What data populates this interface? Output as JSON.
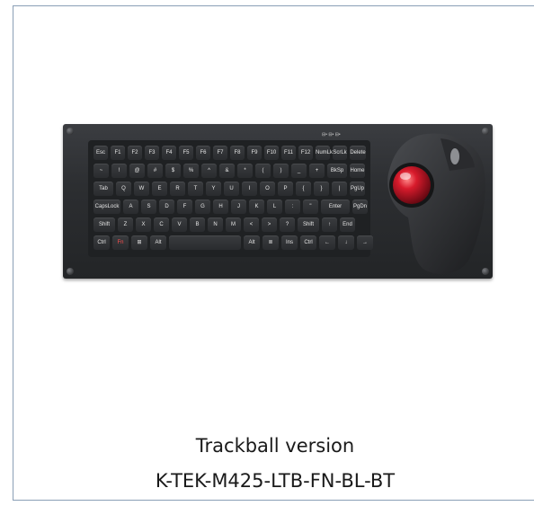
{
  "caption": {
    "line1": "Trackball version",
    "line2": "K-TEK-M425-LTB-FN-BL-BT"
  },
  "keyboard": {
    "row1": [
      "Esc",
      "F1",
      "F2",
      "F3",
      "F4",
      "F5",
      "F6",
      "F7",
      "F8",
      "F9",
      "F10",
      "F11",
      "F12",
      "NumLk",
      "ScrLk",
      "Delete"
    ],
    "row2": [
      "~",
      "!",
      "@",
      "#",
      "$",
      "%",
      "^",
      "&",
      "*",
      "(",
      ")",
      "_",
      "+",
      "BkSp",
      "Home"
    ],
    "row3": [
      "Tab",
      "Q",
      "W",
      "E",
      "R",
      "T",
      "Y",
      "U",
      "I",
      "O",
      "P",
      "{",
      "}",
      "|",
      "PgUp"
    ],
    "row4": [
      "CapsLock",
      "A",
      "S",
      "D",
      "F",
      "G",
      "H",
      "J",
      "K",
      "L",
      ":",
      "\"",
      "Enter",
      "PgDn"
    ],
    "row5": [
      "Shift",
      "Z",
      "X",
      "C",
      "V",
      "B",
      "N",
      "M",
      "<",
      ">",
      "?",
      "Shift",
      "↑",
      "End"
    ],
    "row6": [
      "Ctrl",
      "Fn",
      "⊞",
      "Alt",
      "",
      "Alt",
      "≣",
      "Ins",
      "Ctrl",
      "←",
      "↓",
      "→"
    ]
  },
  "colors": {
    "panel": "#2c2e31",
    "trackball": "#c8102e",
    "border": "#8a9fb6"
  }
}
